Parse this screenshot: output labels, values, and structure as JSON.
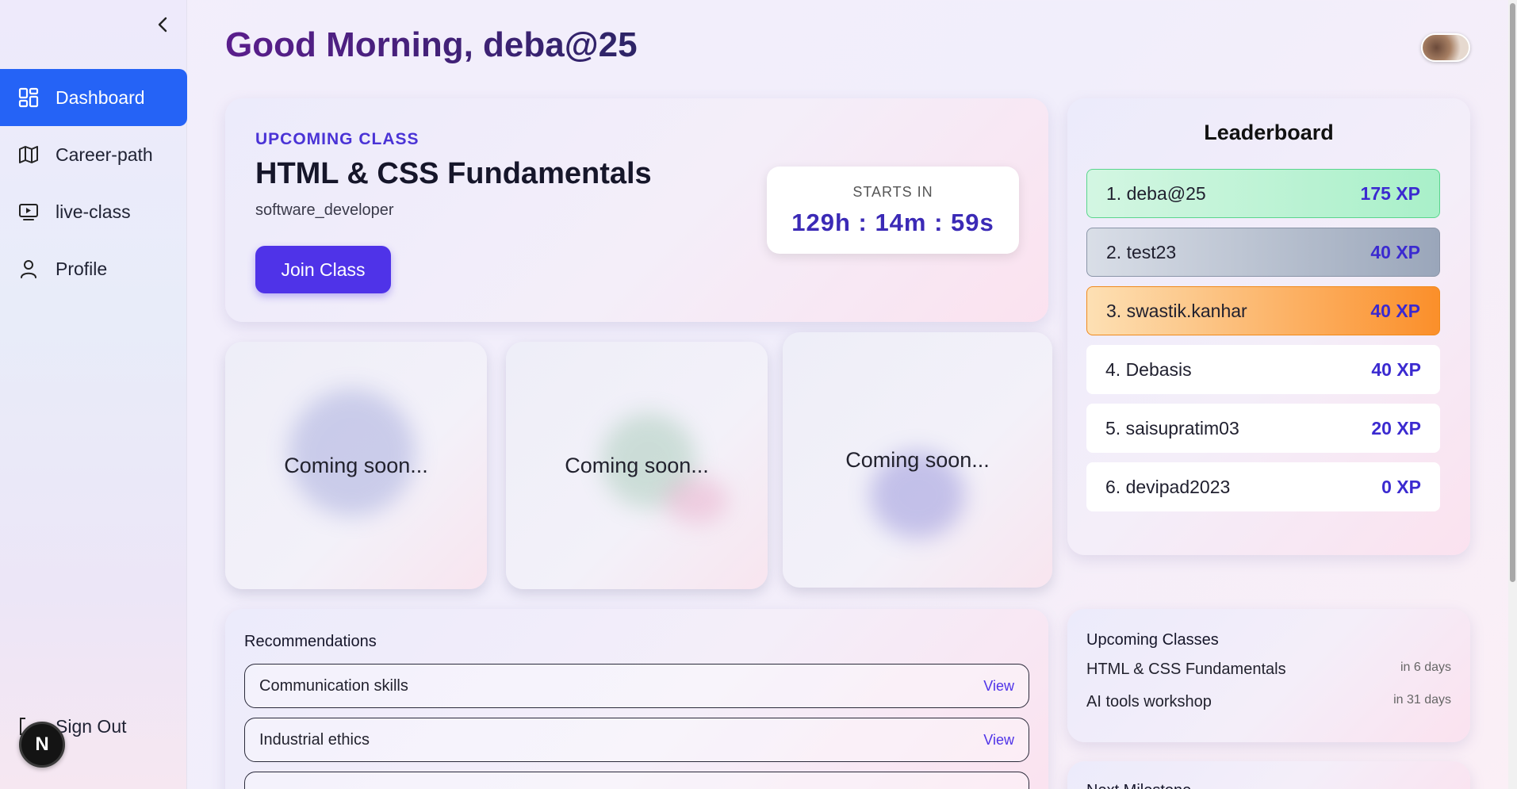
{
  "header": {
    "greeting": "Good Morning, deba@25"
  },
  "sidebar": {
    "items": [
      {
        "label": "Dashboard",
        "icon": "dashboard-icon",
        "active": true
      },
      {
        "label": "Career-path",
        "icon": "map-icon",
        "active": false
      },
      {
        "label": "live-class",
        "icon": "video-icon",
        "active": false
      },
      {
        "label": "Profile",
        "icon": "user-icon",
        "active": false
      }
    ],
    "signout_label": "Sign Out",
    "badge_letter": "N"
  },
  "upcoming_class": {
    "label": "UPCOMING CLASS",
    "title": "HTML & CSS Fundamentals",
    "subtitle": "software_developer",
    "join_label": "Join Class",
    "starts_in_label": "STARTS IN",
    "countdown": "129h : 14m : 59s"
  },
  "placeholders": [
    {
      "text": "Coming soon..."
    },
    {
      "text": "Coming soon..."
    },
    {
      "text": "Coming soon..."
    }
  ],
  "recommendations": {
    "title": "Recommendations",
    "items": [
      {
        "name": "Communication skills",
        "action": "View"
      },
      {
        "name": "Industrial ethics",
        "action": "View"
      }
    ]
  },
  "leaderboard": {
    "title": "Leaderboard",
    "rows": [
      {
        "name": "1. deba@25",
        "xp": "175 XP"
      },
      {
        "name": "2. test23",
        "xp": "40 XP"
      },
      {
        "name": "3. swastik.kanhar",
        "xp": "40 XP"
      },
      {
        "name": "4. Debasis",
        "xp": "40 XP"
      },
      {
        "name": "5. saisupratim03",
        "xp": "20 XP"
      },
      {
        "name": "6. devipad2023",
        "xp": "0 XP"
      }
    ]
  },
  "upcoming_classes": {
    "title": "Upcoming Classes",
    "items": [
      {
        "name": "HTML & CSS Fundamentals",
        "when": "in 6 days"
      },
      {
        "name": "AI tools workshop",
        "when": "in 31 days"
      }
    ]
  },
  "milestone": {
    "title": "Next Milestone"
  },
  "colors": {
    "accent": "#2563f6",
    "brand_purple": "#4f33e8",
    "gold": "#5ad58d",
    "silver": "#8a95a8",
    "bronze": "#f08a1c"
  }
}
